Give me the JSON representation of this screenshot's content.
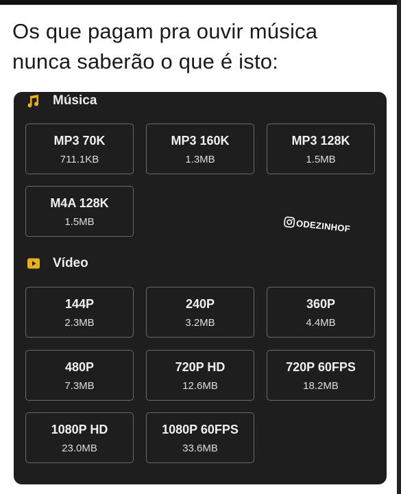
{
  "caption": {
    "line1": "Os que pagam pra ouvir música",
    "line2": "nunca saberão o que é isto:"
  },
  "watermark": {
    "text": "ODEZINHOF",
    "icon": "instagram-icon"
  },
  "music": {
    "title": "Música",
    "icon": "music-note-icon",
    "icon_color": "#e8b01e",
    "options": [
      {
        "label": "MP3 70K",
        "size": "711.1KB"
      },
      {
        "label": "MP3 160K",
        "size": "1.3MB"
      },
      {
        "label": "MP3 128K",
        "size": "1.5MB"
      },
      {
        "label": "M4A 128K",
        "size": "1.5MB"
      }
    ]
  },
  "video": {
    "title": "Vídeo",
    "icon": "video-play-icon",
    "icon_color": "#e8b01e",
    "options": [
      {
        "label": "144P",
        "size": "2.3MB"
      },
      {
        "label": "240P",
        "size": "3.2MB"
      },
      {
        "label": "360P",
        "size": "4.4MB"
      },
      {
        "label": "480P",
        "size": "7.3MB"
      },
      {
        "label": "720P HD",
        "size": "12.6MB"
      },
      {
        "label": "720P 60FPS",
        "size": "18.2MB"
      },
      {
        "label": "1080P HD",
        "size": "23.0MB"
      },
      {
        "label": "1080P 60FPS",
        "size": "33.6MB"
      }
    ]
  }
}
